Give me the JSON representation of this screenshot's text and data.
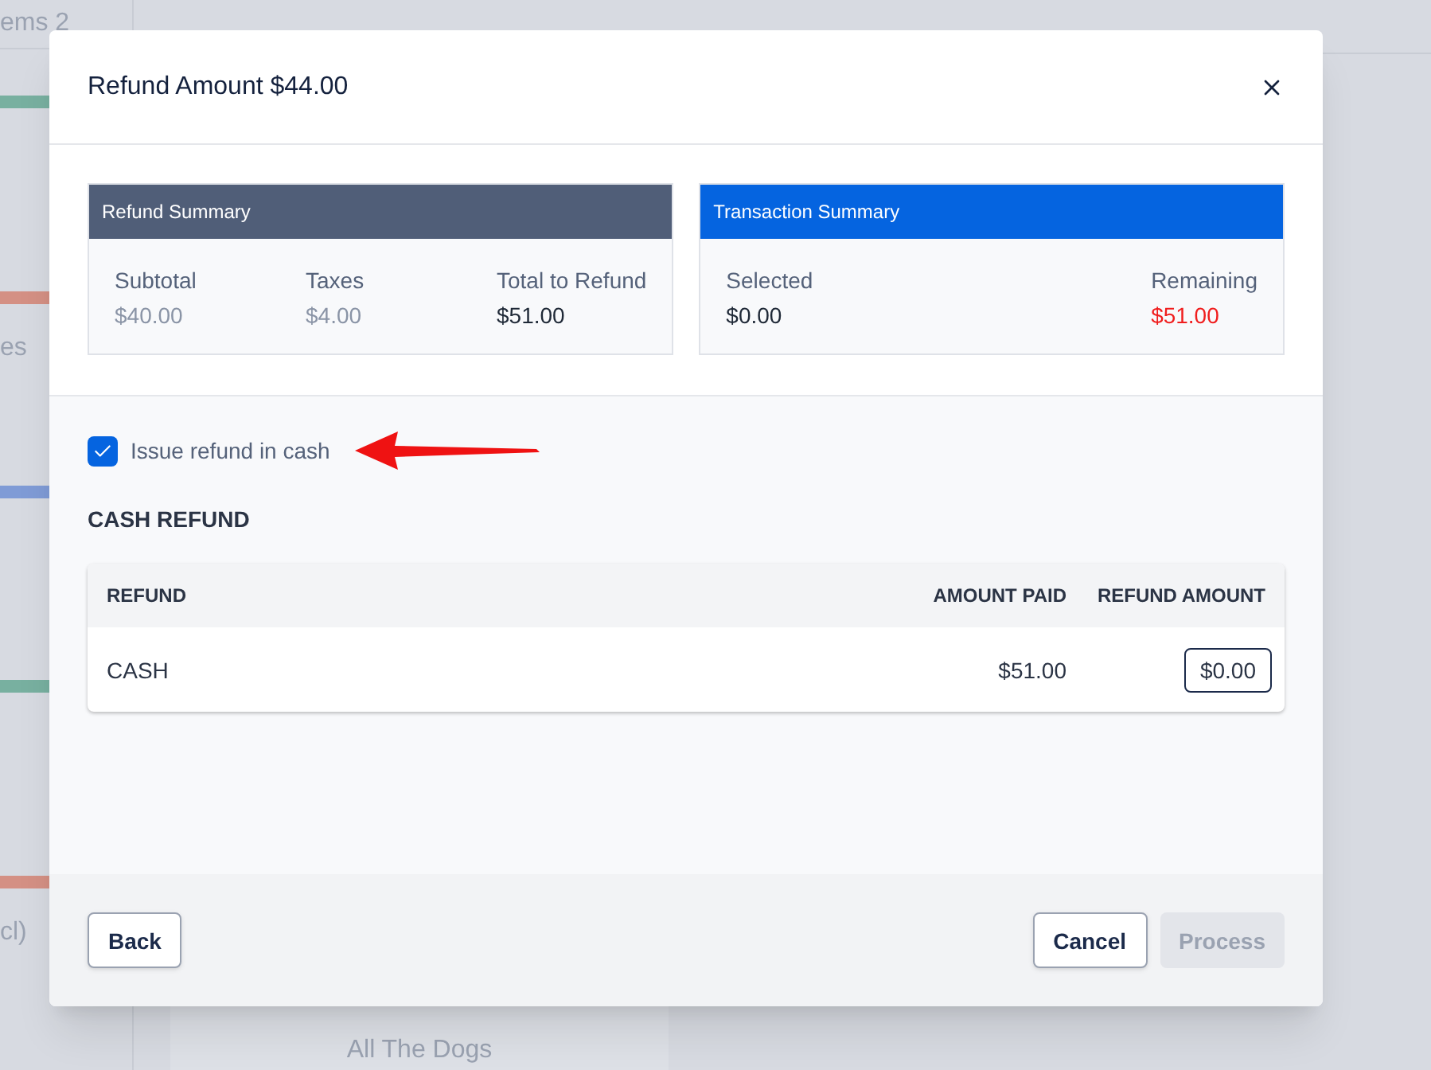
{
  "background": {
    "tab": "ems 2",
    "side_labels": [
      "es",
      "cl)"
    ],
    "panel_text": "All The Dogs"
  },
  "dialog": {
    "title": "Refund Amount $44.00",
    "summaries": [
      {
        "title": "Refund Summary",
        "kind": "refund",
        "items": [
          {
            "label": "Subtotal",
            "value": "$40.00",
            "color": "#8a94a6"
          },
          {
            "label": "Taxes",
            "value": "$4.00",
            "color": "#8a94a6"
          },
          {
            "label": "Total to Refund",
            "value": "$51.00",
            "color": "#1f2937"
          }
        ]
      },
      {
        "title": "Transaction Summary",
        "kind": "transaction",
        "items": [
          {
            "label": "Selected",
            "value": "$0.00",
            "color": "#1f2937"
          },
          {
            "label": "Remaining",
            "value": "$51.00",
            "color": "#f01e1e"
          }
        ]
      }
    ],
    "cash_option": {
      "label": "Issue refund in cash",
      "checked": true
    },
    "section_title": "CASH REFUND",
    "table": {
      "columns": [
        "REFUND",
        "AMOUNT PAID",
        "REFUND AMOUNT"
      ],
      "rows": [
        {
          "refund": "CASH",
          "amount_paid": "$51.00",
          "refund_amount": "$0.00"
        }
      ]
    },
    "buttons": [
      {
        "label": "Back",
        "disabled": false
      },
      {
        "label": "Cancel",
        "disabled": false
      },
      {
        "label": "Process",
        "disabled": true
      }
    ]
  }
}
